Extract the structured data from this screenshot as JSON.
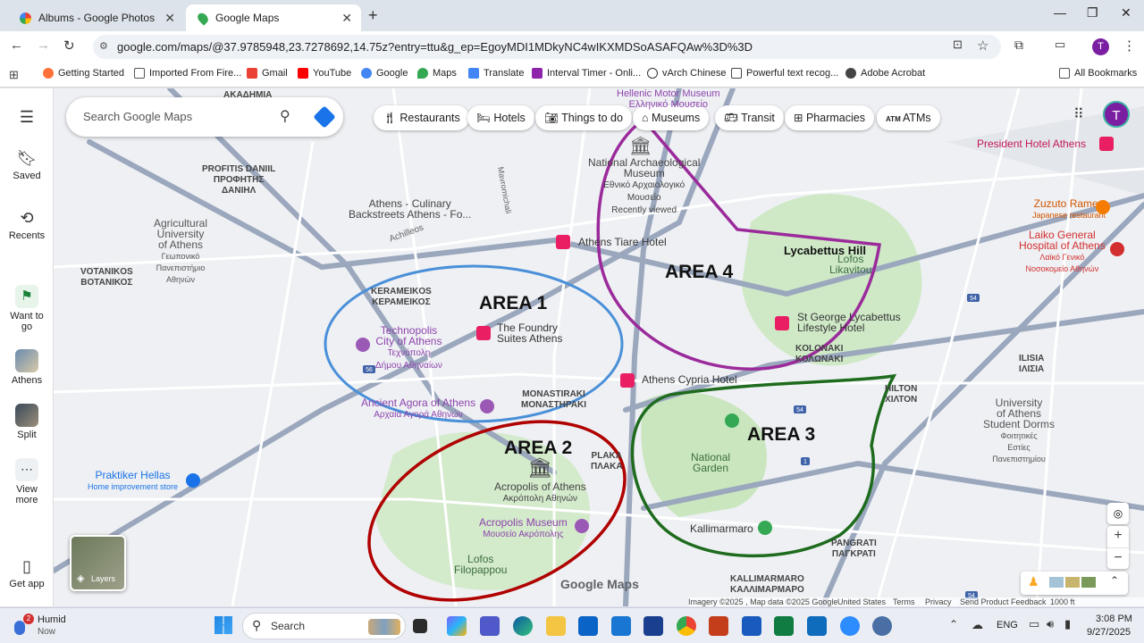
{
  "browser": {
    "tabs": [
      {
        "title": "Albums - Google Photos"
      },
      {
        "title": "Google Maps"
      }
    ],
    "new_tab": "+",
    "url": "google.com/maps/@37.9785948,23.7278692,14.75z?entry=ttu&g_ep=EgoyMDI1MDkyNC4wIKXMDSoASAFQAw%3D%3D",
    "bookmarks": [
      "Getting Started",
      "Imported From Fire...",
      "Gmail",
      "YouTube",
      "Google",
      "Maps",
      "Translate",
      "Interval Timer - Onli...",
      "vArch Chinese",
      "Powerful text recog...",
      "Adobe Acrobat"
    ],
    "all_bookmarks": "All Bookmarks",
    "profile_initial": "T"
  },
  "rail": {
    "saved": "Saved",
    "recents": "Recents",
    "want_to_go": "Want to go",
    "athens": "Athens",
    "split": "Split",
    "view_more": "View more",
    "get_app": "Get app"
  },
  "search": {
    "placeholder": "Search Google Maps"
  },
  "chips": [
    "Restaurants",
    "Hotels",
    "Things to do",
    "Museums",
    "Transit",
    "Pharmacies",
    "ATMs"
  ],
  "map": {
    "areas": {
      "a1": "AREA 1",
      "a2": "AREA 2",
      "a3": "AREA 3",
      "a4": "AREA 4"
    },
    "lycabettus": "Lycabettus Hill",
    "labels": {
      "akadimia": "ΑΚΑΔΗΜΙΑ",
      "hellenic_museum": "Hellenic Motor Museum",
      "hellenic_museum_gr": "Ελληνικό Μουσείο",
      "profitis": "PROFITIS DANIIL",
      "profitis_gr1": "ΠΡΟΦΗΤΗΣ",
      "profitis_gr2": "ΔΑΝΙΗΛ",
      "nat_arch1": "National Archaeological",
      "nat_arch2": "Museum",
      "nat_arch_gr1": "Εθνικό Αρχαιολογικό",
      "nat_arch_gr2": "Μουσείο",
      "recently": "Recently viewed",
      "culinary1": "Athens - Culinary",
      "culinary2": "Backstreets Athens - Fo...",
      "agri1": "Agricultural",
      "agri2": "University",
      "agri3": "of Athens",
      "agri_gr1": "Γεωπονικό",
      "agri_gr2": "Πανεπιστήμιο",
      "agri_gr3": "Αθηνών",
      "votanikos": "VOTANIKOS",
      "votanikos_gr": "ΒΟΤΑΝΙΚΟΣ",
      "achilleos": "Achilleos",
      "tiare": "Athens Tiare Hotel",
      "kerameikos": "KERAMEIKOS",
      "kerameikos_gr": "ΚΕΡΑΜΕΙΚΟΣ",
      "foundry1": "The Foundry",
      "foundry2": "Suites Athens",
      "technopolis1": "Technopolis",
      "technopolis2": "City of Athens",
      "technopolis_gr1": "Τεχνόπολη",
      "technopolis_gr2": "Δήμου Αθηναίων",
      "monastiraki": "MONASTIRAKI",
      "monastiraki_gr": "ΜΟΝΑΣΤΗΡΑΚΙ",
      "agora": "Ancient Agora of Athens",
      "agora_gr": "Αρχαία Αγορά Αθηνών",
      "cypria": "Athens Cypria Hotel",
      "st_george1": "St George Lycabettus",
      "st_george2": "Lifestyle Hotel",
      "lofos_lik1": "Lofos",
      "lofos_lik2": "Likavitou",
      "kolonaki": "KOLONAKI",
      "kolonaki_gr": "ΚΟΛΩΝΑΚΙ",
      "president": "President Hotel Athens",
      "zuzuto": "Zuzuto Ramen",
      "zuzuto_sub": "Japanese restaurant",
      "laiko1": "Laiko General",
      "laiko2": "Hospital of Athens",
      "laiko_gr1": "Λαϊκό Γενικό",
      "laiko_gr2": "Νοσοκομείο Αθηνών",
      "ilisia": "ILISIA",
      "ilisia_gr": "ΙΛΙΣΙΑ",
      "hilton": "HILTON",
      "hilton_gr": "ΧΙΛΤΟΝ",
      "univ1": "University",
      "univ2": "of Athens",
      "univ3": "Student Dorms",
      "univ_gr1": "Φοιτητικές",
      "univ_gr2": "Εστίες",
      "univ_gr3": "Πανεπιστημίου",
      "plaka": "PLAKA",
      "plaka_gr": "ΠΛΑΚΑ",
      "national_garden1": "National",
      "national_garden2": "Garden",
      "praktiker": "Praktiker Hellas",
      "praktiker_sub": "Home improvement store",
      "acropolis": "Acropolis of Athens",
      "acropolis_gr": "Ακρόπολη Αθηνών",
      "acro_museum": "Acropolis Museum",
      "acro_museum_gr": "Μουσείο Ακρόπολης",
      "lofos_fil1": "Lofos",
      "lofos_fil2": "Filopappou",
      "kallimarmaro": "Kallimarmaro",
      "pangrati": "PANGRATI",
      "pangrati_gr": "ΠΑΓΚΡΑΤΙ",
      "kallimarmaro_up": "KALLIMARMARO",
      "kallimarmaro_gr": "ΚΑΛΛΙΜΑΡΜΑΡΟ",
      "layers": "Layers",
      "logo": "Google Maps",
      "mavromichali": "Mavromichali"
    },
    "footer": [
      "Imagery ©2025 , Map data ©2025 Google",
      "United States",
      "Terms",
      "Privacy",
      "Send Product Feedback",
      "1000 ft"
    ]
  },
  "taskbar": {
    "weather_badge": "2",
    "weather": "Humid",
    "weather_sub": "Now",
    "search": "Search",
    "lang": "ENG",
    "time": "3:08 PM",
    "date": "9/27/2025"
  },
  "colors": {
    "area1": "#4a90d9",
    "area2": "#b00000",
    "area3": "#1e6b1e",
    "area4": "#9b2a9b",
    "purple_poi": "#9b59b6",
    "hotel_pink": "#e91e63"
  }
}
